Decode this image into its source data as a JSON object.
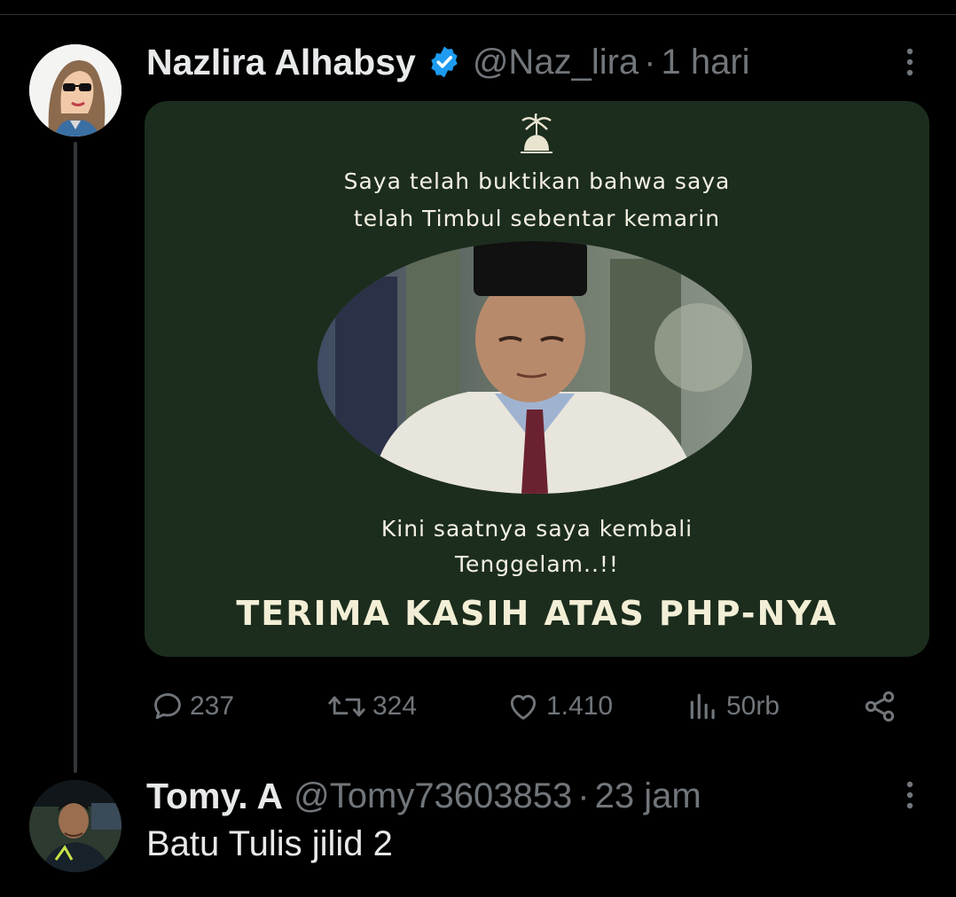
{
  "tweet": {
    "author_name": "Nazlira Alhabsy",
    "handle": "@Naz_lira",
    "separator": "·",
    "time": "1 hari",
    "verified": true,
    "media": {
      "line1": "Saya telah buktikan bahwa saya",
      "line2": "telah Timbul sebentar kemarin",
      "line3": "Kini saatnya saya kembali",
      "line4": "Tenggelam..!!",
      "title": "TERIMA KASIH ATAS PHP-NYA",
      "background_color": "#1c2d1d"
    },
    "actions": {
      "replies": "237",
      "reposts": "324",
      "likes": "1.410",
      "views": "50rb"
    }
  },
  "reply": {
    "author_name": "Tomy. A",
    "handle": "@Tomy73603853",
    "separator": "·",
    "time": "23 jam",
    "text": "Batu Tulis jilid 2"
  },
  "icons": {
    "verified": "verified-badge-icon",
    "more": "more-vertical-icon",
    "reply": "comment-icon",
    "repost": "repost-icon",
    "like": "heart-icon",
    "views": "views-icon",
    "share": "share-icon"
  },
  "colors": {
    "background": "#000000",
    "text_primary": "#e7e9ea",
    "text_secondary": "#71767b",
    "verified_blue": "#1d9bf0"
  }
}
